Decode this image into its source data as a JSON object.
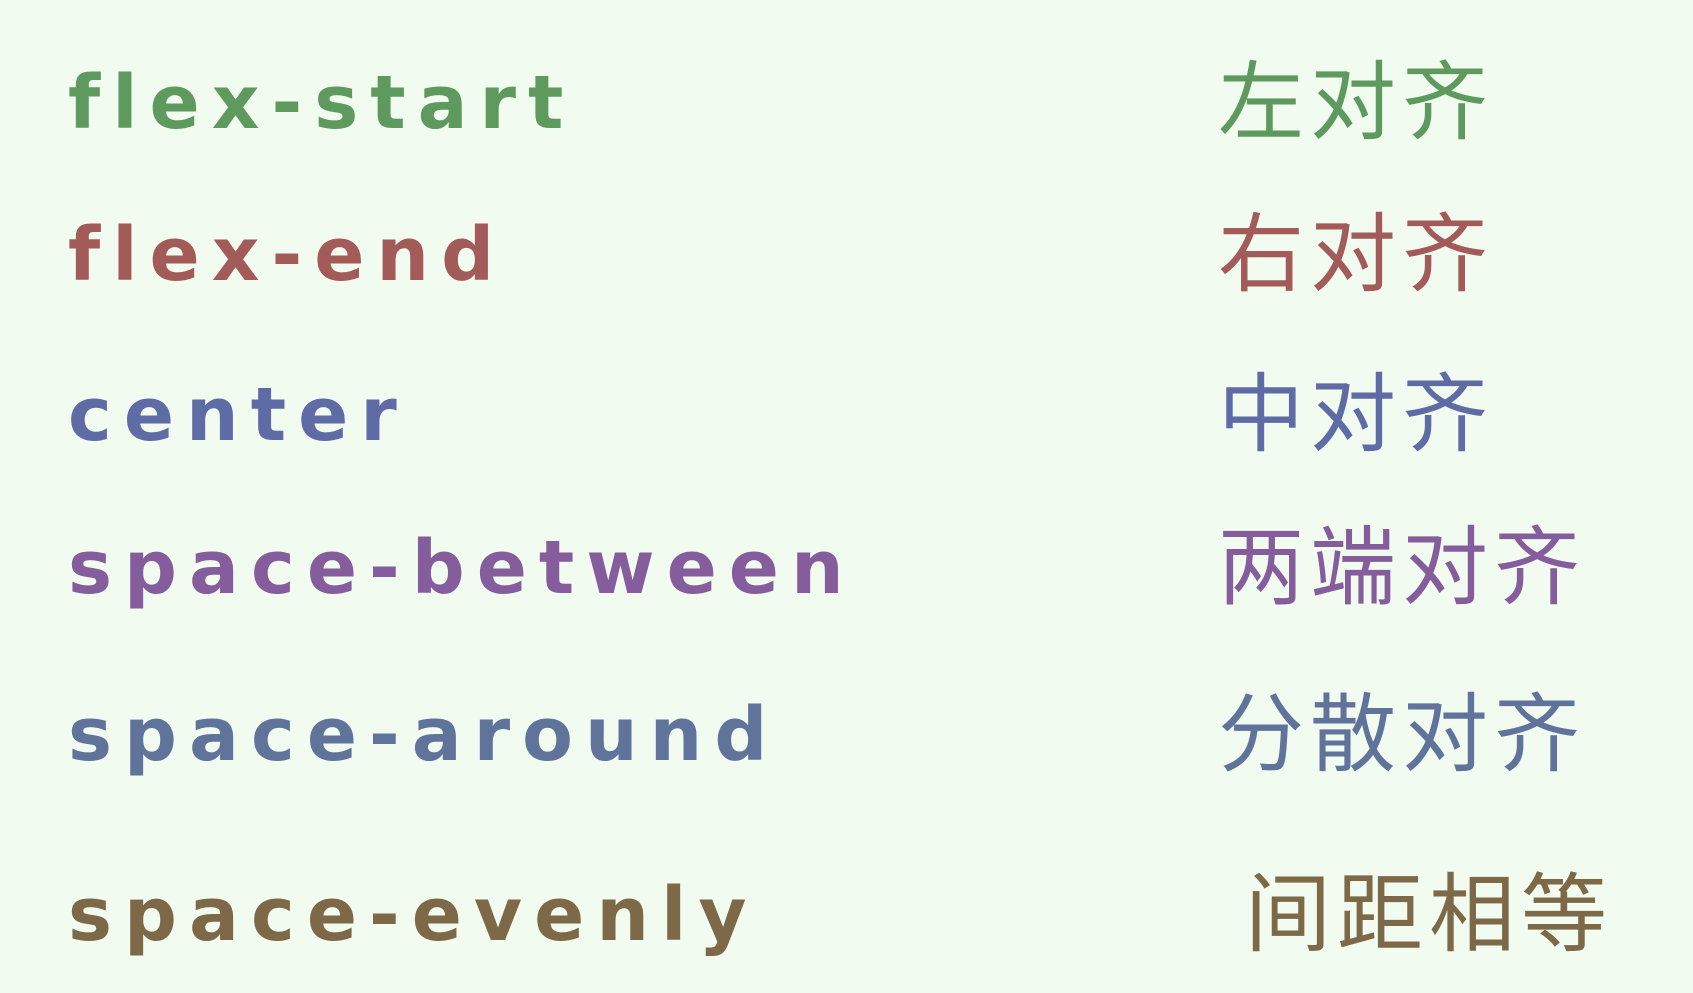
{
  "items": [
    {
      "term": "flex-start",
      "meaning": "左对齐",
      "color": "#5e9a5e"
    },
    {
      "term": "flex-end",
      "meaning": "右对齐",
      "color": "#a25b58"
    },
    {
      "term": "center",
      "meaning": "中对齐",
      "color": "#5f6ba5"
    },
    {
      "term": "space-between",
      "meaning": "两端对齐",
      "color": "#855d9c"
    },
    {
      "term": "space-around",
      "meaning": "分散对齐",
      "color": "#60739b"
    },
    {
      "term": "space-evenly",
      "meaning": "间距相等",
      "color": "#7d6847"
    }
  ]
}
